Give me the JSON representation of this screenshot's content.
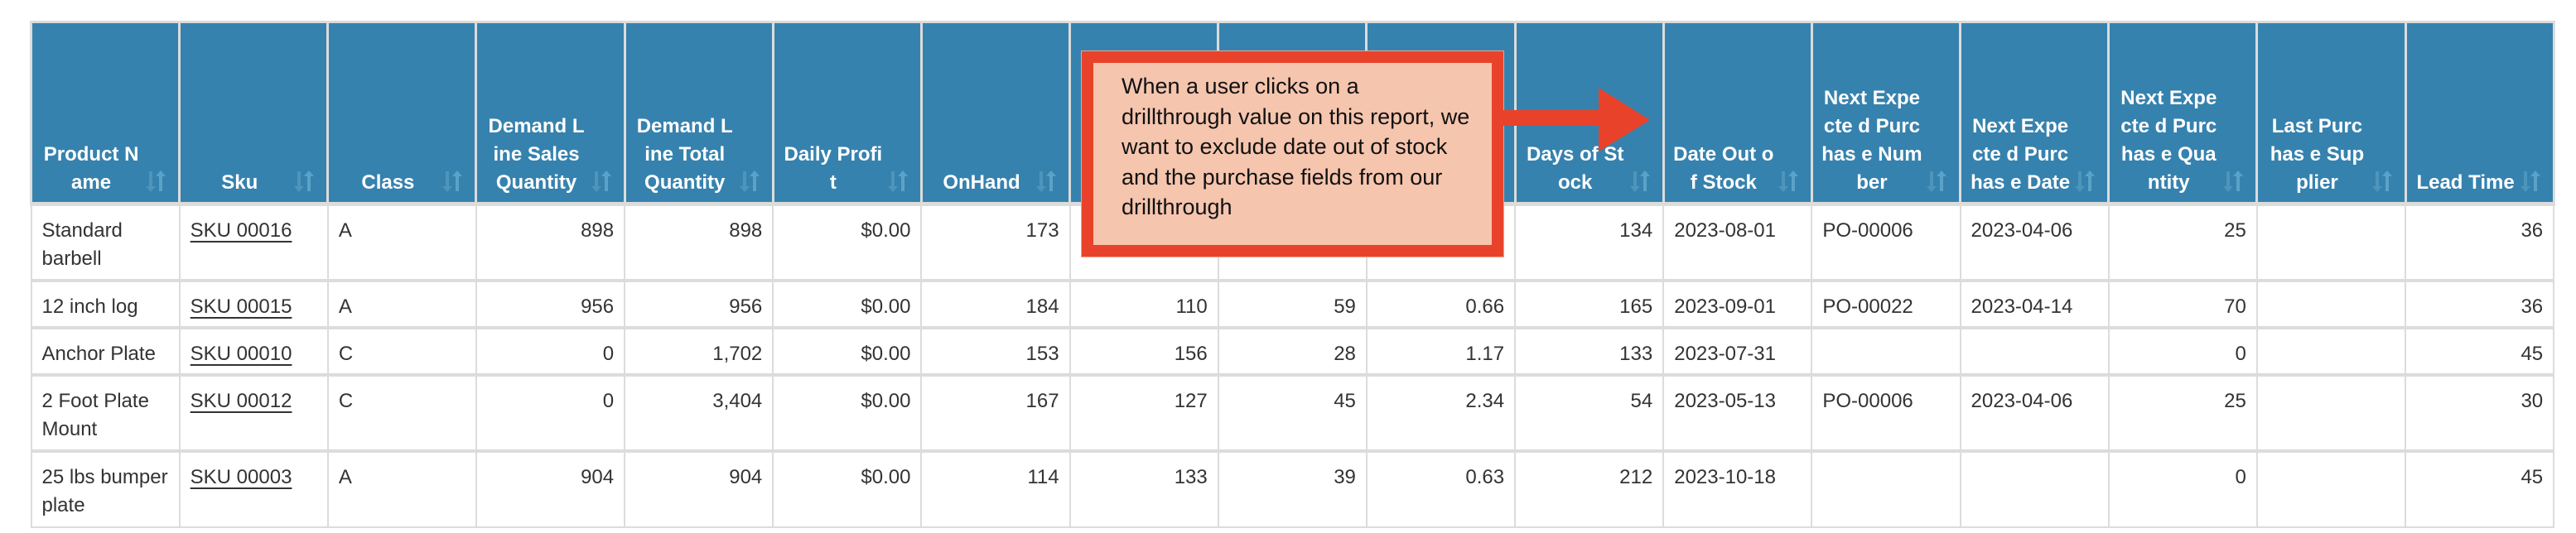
{
  "table": {
    "columns": [
      {
        "label": "Product Name",
        "align": "left"
      },
      {
        "label": "Sku",
        "align": "left"
      },
      {
        "label": "Class",
        "align": "left"
      },
      {
        "label": "Demand Line Sales Quantity",
        "align": "right"
      },
      {
        "label": "Demand Line Total Quantity",
        "align": "right"
      },
      {
        "label": "Daily Profit",
        "align": "right"
      },
      {
        "label": "OnHand",
        "align": "right"
      },
      {
        "label": "",
        "align": "right"
      },
      {
        "label": "",
        "align": "right"
      },
      {
        "label": "",
        "align": "right"
      },
      {
        "label": "Days of Stock",
        "align": "right"
      },
      {
        "label": "Date Out of Stock",
        "align": "left"
      },
      {
        "label": "Next Expected Purchase Number",
        "align": "left"
      },
      {
        "label": "Next Expected Purchase Date",
        "align": "left"
      },
      {
        "label": "Next Expected Purchase Quantity",
        "align": "right"
      },
      {
        "label": "Last Purchase Supplier",
        "align": "left"
      },
      {
        "label": "Lead Time",
        "align": "right"
      }
    ],
    "header_display": [
      "Product Name",
      "Sku",
      "Class",
      "Demand Line Sales Quantity",
      "Demand Line Total Quantity",
      "Daily Profit",
      "OnHand",
      "",
      "",
      "",
      "Days of Stock",
      "Date Out of Stock",
      "Next Expecte d Purchas e Number",
      "Next Expecte d Purchas e Date",
      "Next Expecte d Purchas e Quantity",
      "Last Purchas e Supplier",
      "Lead Time"
    ],
    "rows": [
      [
        "Standard barbell",
        "SKU 00016",
        "A",
        "898",
        "898",
        "$0.00",
        "173",
        "",
        "",
        "",
        "134",
        "2023-08-01",
        "PO-00006",
        "2023-04-06",
        "25",
        "",
        "36"
      ],
      [
        "12 inch log",
        "SKU 00015",
        "A",
        "956",
        "956",
        "$0.00",
        "184",
        "110",
        "59",
        "0.66",
        "165",
        "2023-09-01",
        "PO-00022",
        "2023-04-14",
        "70",
        "",
        "36"
      ],
      [
        "Anchor Plate",
        "SKU 00010",
        "C",
        "0",
        "1,702",
        "$0.00",
        "153",
        "156",
        "28",
        "1.17",
        "133",
        "2023-07-31",
        "",
        "",
        "0",
        "",
        "45"
      ],
      [
        "2 Foot Plate Mount",
        "SKU 00012",
        "C",
        "0",
        "3,404",
        "$0.00",
        "167",
        "127",
        "45",
        "2.34",
        "54",
        "2023-05-13",
        "PO-00006",
        "2023-04-06",
        "25",
        "",
        "30"
      ],
      [
        "25 lbs bumper plate",
        "SKU 00003",
        "A",
        "904",
        "904",
        "$0.00",
        "114",
        "133",
        "39",
        "0.63",
        "212",
        "2023-10-18",
        "",
        "",
        "0",
        "",
        "45"
      ]
    ],
    "row_heights": [
      "tall",
      "short",
      "short",
      "tall",
      "tall"
    ],
    "sort_icon": "sort-updown-icon"
  },
  "annotation": {
    "text": "When a user clicks on a drillthrough value on this report, we want to exclude date out of stock and the purchase fields from our drillthrough",
    "arrow_icon": "right-arrow-icon"
  },
  "colors": {
    "header_bg": "#3682AE",
    "header_text": "#FFFFFF",
    "grid": "#DCDCDC",
    "body_text": "#333333",
    "annotation_border": "#E8432A",
    "annotation_fill": "#F5C5AE",
    "sort_icon_down": "#4D95BD",
    "sort_icon_up": "#5AA2C8"
  }
}
